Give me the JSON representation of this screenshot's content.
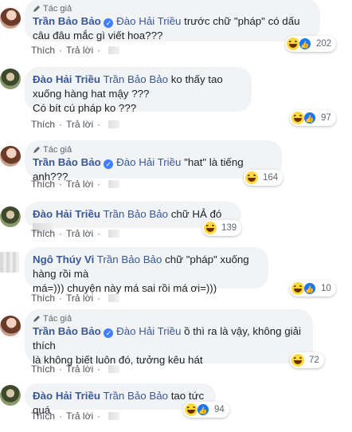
{
  "labels": {
    "author": "Tác giả",
    "like": "Thích",
    "reply": "Trả lời",
    "sep": "·"
  },
  "comments": [
    {
      "name": "Trần Bảo Bảo",
      "mention": "Đào Hải Triều",
      "text": "trước chữ \"pháp\" có dấu câu đâu mắc gì viết hoa???",
      "count": "202"
    },
    {
      "name": "Đào Hải Triều",
      "mention": "Trần Bảo Bảo",
      "text": "ko thấy tao xuống hàng hat mậy ???",
      "text2": "Có bít cú pháp ko ???",
      "count": "97"
    },
    {
      "name": "Trần Bảo Bảo",
      "mention": "Đào Hải Triều",
      "text": "\"hat\" là tiếng anh???",
      "count": "164"
    },
    {
      "name": "Đào Hải Triều",
      "mention": "Trần Bảo Bảo",
      "text": "chữ HẢ đó",
      "count": "139"
    },
    {
      "name": "Ngô Thúy Vi",
      "mention": "Trần Bảo Bảo",
      "text": "chữ \"pháp\" xuống hàng rồi mà",
      "text2": "má=))) chuyện này má sai rồi má ơi=)))",
      "count": "10"
    },
    {
      "name": "Trần Bảo Bảo",
      "mention": "Đào Hải Triều",
      "text": "ồ thì ra là vậy, không giải thích",
      "text2": "là không biết luôn đó, tưởng kêu hát",
      "count": "72"
    },
    {
      "name": "Đào Hải Triều",
      "mention": "Trần Bảo Bảo",
      "text": "tao tức quá",
      "count": "94"
    }
  ]
}
